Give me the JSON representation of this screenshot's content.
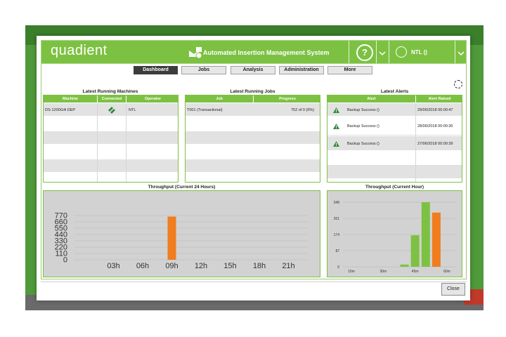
{
  "app": {
    "logo": "quadient",
    "title": "Automated Insertion Management System",
    "help_label": "?",
    "user": "NTL ()"
  },
  "nav": [
    "Dashboard",
    "Jobs",
    "Analysis",
    "Administration",
    "More"
  ],
  "machines": {
    "title": "Latest Running Machines",
    "columns": [
      "Machine",
      "Connected",
      "Operator"
    ],
    "rows": [
      {
        "machine": "DS-1200G4i DEP",
        "connected_icon": "connected-icon",
        "operator": "NTL"
      }
    ]
  },
  "jobs": {
    "title": "Latest Running Jobs",
    "columns": [
      "Job",
      "Progress"
    ],
    "rows": [
      {
        "job": "T001 (Transactional)",
        "progress": "752 of 0 (0%)"
      }
    ]
  },
  "alerts": {
    "title": "Latest Alerts",
    "columns": [
      "Alert",
      "Alert Raised"
    ],
    "rows": [
      {
        "icon": "warning-icon",
        "alert": "Backup Success ()",
        "raised": "29/06/2018 00:00:47"
      },
      {
        "icon": "warning-icon",
        "alert": "Backup Success ()",
        "raised": "28/06/2018 00:00:30"
      },
      {
        "icon": "warning-icon",
        "alert": "Backup Success ()",
        "raised": "27/06/2018 00:00:39"
      }
    ]
  },
  "colors": {
    "accent": "#7dc142",
    "orange": "#f07d1e",
    "green_bar": "#7dc142"
  },
  "chart_data": [
    {
      "type": "bar",
      "title": "Throughput (Current 24 Hours)",
      "x_ticks": [
        "03h",
        "06h",
        "09h",
        "12h",
        "15h",
        "18h",
        "21h"
      ],
      "y_ticks": [
        "770",
        "660",
        "550",
        "440",
        "330",
        "220",
        "110",
        "0"
      ],
      "ylim": [
        0,
        770
      ],
      "grid": true,
      "series": [
        {
          "color": "#f07d1e",
          "points": [
            {
              "hour": 9,
              "value": 752
            }
          ]
        }
      ]
    },
    {
      "type": "bar",
      "title": "Throughput (Current Hour)",
      "x_ticks": [
        "15m",
        "30m",
        "45m",
        "60m"
      ],
      "y_ticks": [
        "348",
        "261",
        "174",
        "87",
        "0"
      ],
      "ylim": [
        0,
        348
      ],
      "grid": true,
      "series": [
        {
          "color": "#7dc142",
          "points": [
            {
              "minute": 40,
              "value": 12
            },
            {
              "minute": 45,
              "value": 170
            },
            {
              "minute": 50,
              "value": 348
            }
          ]
        },
        {
          "color": "#f07d1e",
          "points": [
            {
              "minute": 55,
              "value": 292
            }
          ]
        }
      ]
    }
  ],
  "close_label": "Close"
}
